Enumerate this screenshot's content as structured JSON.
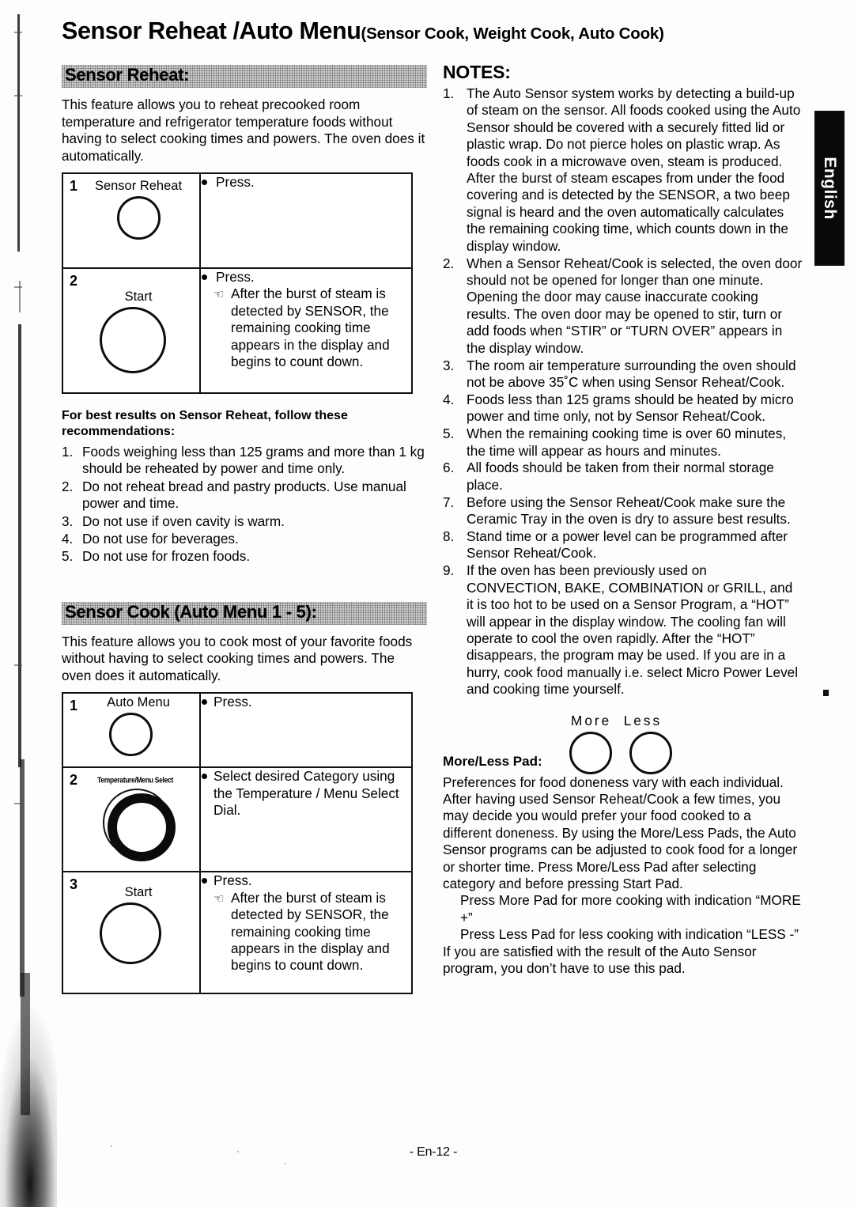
{
  "page": {
    "title_main": "Sensor Reheat /Auto Menu",
    "title_sub": "(Sensor Cook, Weight Cook, Auto Cook)",
    "language_tab": "English",
    "footer": "- En-12 -"
  },
  "sensor_reheat": {
    "heading": "Sensor Reheat:",
    "intro": "This feature allows you to reheat precooked room temperature and refrigerator temperature foods without having to select cooking times and powers. The oven does it automatically.",
    "steps": [
      {
        "num": "1",
        "button_label": "Sensor Reheat",
        "bullet": "Press.",
        "sub_bullet": ""
      },
      {
        "num": "2",
        "button_label": "Start",
        "bullet": "Press.",
        "sub_bullet": "After the burst of steam is detected by SENSOR, the remaining cooking time appears in the display and begins to count down."
      }
    ],
    "recommend_title": "For best results on Sensor Reheat, follow these recommendations:",
    "recommendations": [
      {
        "n": "1.",
        "text": "Foods weighing less than 125 grams and more than 1 kg should be reheated by power and time only."
      },
      {
        "n": "2.",
        "text": "Do not reheat bread and pastry products. Use manual power and time."
      },
      {
        "n": "3.",
        "text": "Do not use if oven cavity is warm."
      },
      {
        "n": "4.",
        "text": "Do not use for beverages."
      },
      {
        "n": "5.",
        "text": "Do not use for frozen foods."
      }
    ]
  },
  "sensor_cook": {
    "heading": "Sensor Cook (Auto Menu 1 - 5):",
    "intro": "This feature allows you to cook most of your favorite foods without having to select cooking times and powers. The oven does it automatically.",
    "steps": [
      {
        "num": "1",
        "button_label": "Auto Menu",
        "bullet": "Press.",
        "sub_bullet": ""
      },
      {
        "num": "2",
        "button_label": "Temperature/Menu Select",
        "bullet": "Select desired Category using the Temperature / Menu Select Dial.",
        "sub_bullet": ""
      },
      {
        "num": "3",
        "button_label": "Start",
        "bullet": "Press.",
        "sub_bullet": "After the burst of steam is detected by SENSOR, the remaining cooking time appears in the display and begins to count down."
      }
    ]
  },
  "notes": {
    "title": "NOTES:",
    "items": [
      {
        "n": "1.",
        "text": "The Auto Sensor system works by detecting a build-up of steam on the sensor. All foods cooked using the Auto Sensor should be covered with a securely fitted lid or plastic wrap. Do not pierce holes on plastic wrap. As foods cook in a microwave oven, steam is produced. After the burst of steam escapes from under the food covering and is detected by the SENSOR, a two beep signal is heard and the oven automatically calculates the remaining cooking time, which counts down in the display window."
      },
      {
        "n": "2.",
        "text": "When a Sensor Reheat/Cook is selected, the oven door should not be opened for longer than one minute. Opening the door may cause inaccurate cooking results. The oven door may be opened to stir, turn or add foods when “STIR” or “TURN OVER” appears in the display window."
      },
      {
        "n": "3.",
        "text": "The room air temperature surrounding the oven should not be above 35˚C when using Sensor Reheat/Cook."
      },
      {
        "n": "4.",
        "text": "Foods less than 125 grams should be heated by micro power and time only, not by Sensor Reheat/Cook."
      },
      {
        "n": "5.",
        "text": "When the remaining cooking time is over 60 minutes, the time will appear as hours and minutes."
      },
      {
        "n": "6.",
        "text": "All foods should be taken from their normal storage place."
      },
      {
        "n": "7.",
        "text": "Before using the Sensor Reheat/Cook make sure the Ceramic Tray in the oven is dry to assure best results."
      },
      {
        "n": "8.",
        "text": "Stand time or a power level can be programmed after Sensor Reheat/Cook."
      },
      {
        "n": "9.",
        "text": "If the oven has been previously used on CONVECTION, BAKE, COMBINATION or GRILL, and it is too hot to be used on a Sensor Program, a “HOT” will appear in the display window. The cooling fan will operate to cool the oven rapidly. After the “HOT” disappears, the program may be used. If you are in a hurry, cook food manually i.e. select Micro Power Level and cooking time yourself."
      }
    ]
  },
  "more_less": {
    "label_more": "More",
    "label_less": "Less",
    "title": "More/Less Pad:",
    "body": "Preferences for food doneness vary with each individual. After having used Sensor Reheat/Cook a few times, you may decide you would prefer your food cooked to a different doneness. By using the More/Less Pads, the Auto Sensor programs can be adjusted to cook food for a longer or shorter time. Press More/Less Pad after selecting category and before pressing Start Pad.",
    "indent_more": "Press More Pad for more cooking with indication “MORE +”",
    "indent_less": "Press Less Pad for less cooking with indication “LESS -”",
    "closing": "If you are satisfied with the result of the Auto Sensor program, you don’t have to use this pad."
  }
}
